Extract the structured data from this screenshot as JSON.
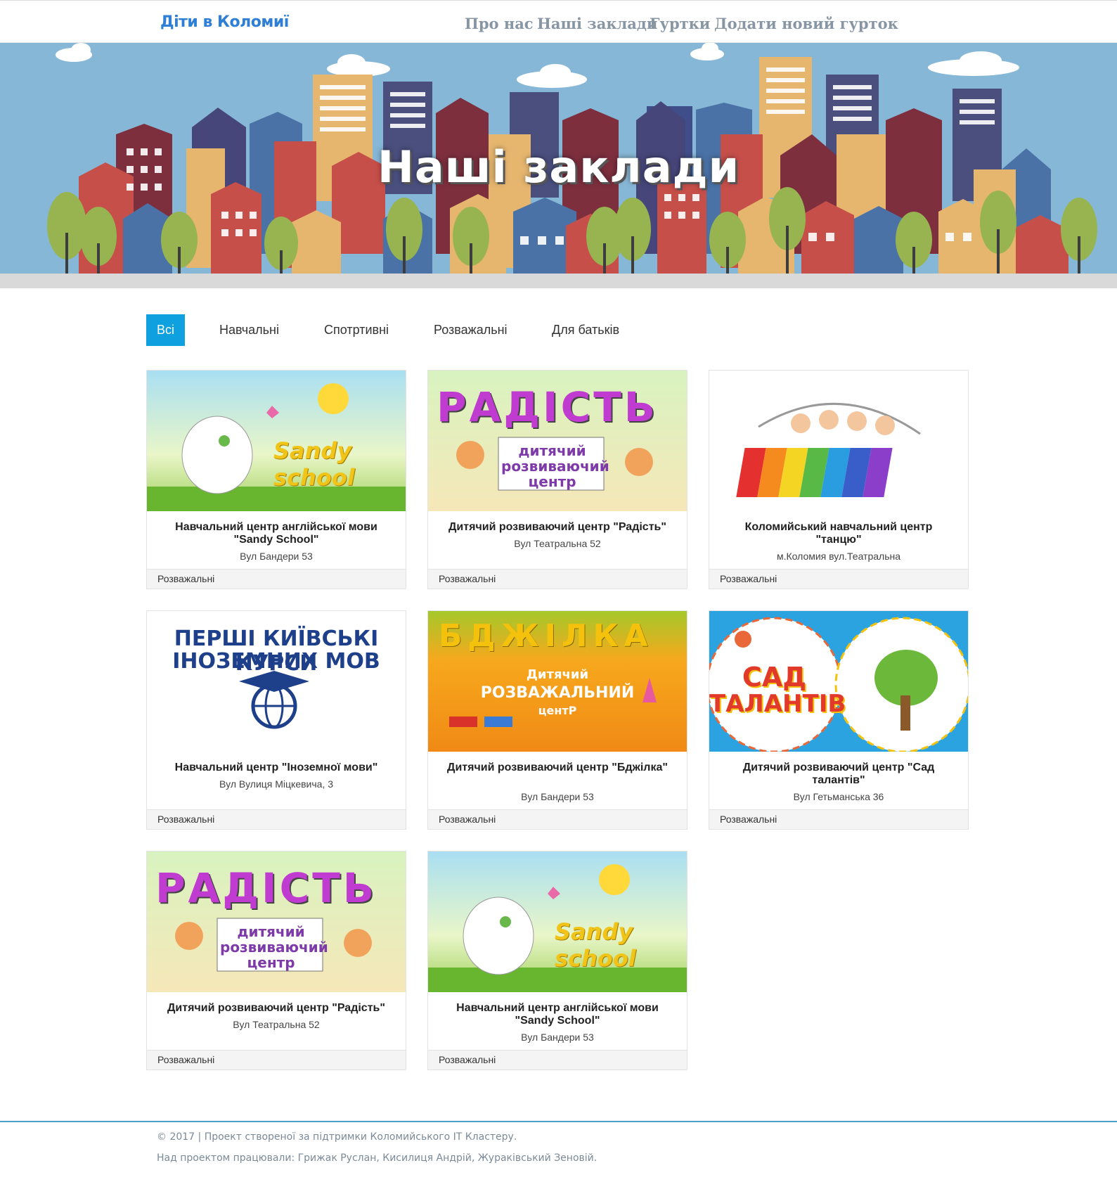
{
  "header": {
    "logo": "Діти в Коломиї",
    "nav": [
      "Про нас",
      "Наші заклади",
      "Гуртки",
      "Додати новий гурток"
    ]
  },
  "hero": {
    "title": "Наші заклади"
  },
  "filters": [
    "Всі",
    "Навчальні",
    "Спотртивні",
    "Розважальні",
    "Для батьків"
  ],
  "cards": [
    {
      "name": "Навчальний центр англійської мови \"Sandy School\"",
      "address": "Вул Бандери 53",
      "category": "Розважальні",
      "image_text": "Sandy school"
    },
    {
      "name": "Дитячий розвиваючий центр \"Радість\"",
      "address": "Вул Театральна 52",
      "category": "Розважальні",
      "image_text": [
        "РАДІСТЬ",
        "дитячий розвиваючий центр"
      ]
    },
    {
      "name": "Коломийський навчальний центр \"танцю\"",
      "address": "м.Коломия вул.Театральна",
      "category": "Розважальні"
    },
    {
      "name": "Навчальний центр \"Іноземної мови\"",
      "address": "Вул Вулиця Міцкевича, 3",
      "category": "Розважальні",
      "image_text": [
        "ПЕРШІ КИЇВСЬКІ КУРСИ",
        "ІНОЗЕМНИХ МОВ"
      ]
    },
    {
      "name": "Дитячий розвиваючий центр \"Бджілка\"",
      "address": "Вул Бандери 53",
      "category": "Розважальні",
      "image_text": [
        "БДЖІЛКА",
        "Дитячий",
        "РОЗВАЖАЛЬНИЙ",
        "центР"
      ]
    },
    {
      "name": "Дитячий розвиваючий центр \"Сад талантів\"",
      "address": "Вул Гетьманська 36",
      "category": "Розважальні",
      "image_text": [
        "САД",
        "ТАЛАНТІВ"
      ]
    },
    {
      "name": "Дитячий розвиваючий центр \"Радість\"",
      "address": "Вул Театральна 52",
      "category": "Розважальні",
      "image_text": [
        "РАДІСТЬ",
        "дитячий розвиваючий центр"
      ]
    },
    {
      "name": "Навчальний центр англійської мови \"Sandy School\"",
      "address": "Вул Бандери 53",
      "category": "Розважальні",
      "image_text": "Sandy school"
    }
  ],
  "footer": {
    "line1": "© 2017 | Проект створеної за підтримки Коломийського ІТ Кластеру.",
    "line2": "Над проектом працювали: Грижак Руслан, Кисилиця Андрій, Жураківський Зеновій."
  }
}
